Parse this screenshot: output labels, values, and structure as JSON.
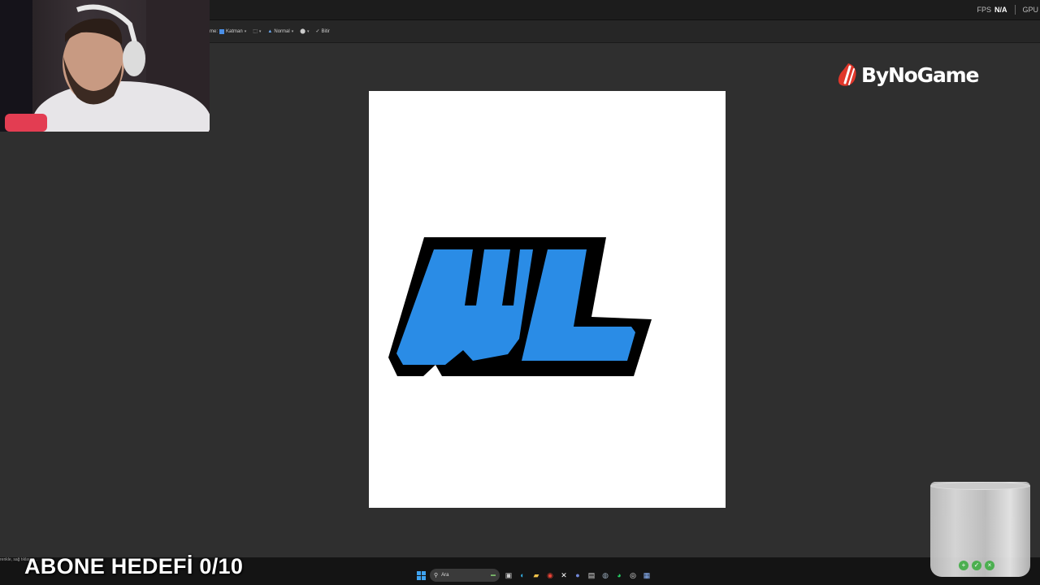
{
  "stats": {
    "fps_label": "FPS",
    "fps_value": "N/A",
    "gpu_label": "GPU"
  },
  "options_bar": {
    "prefix": "me:",
    "layer_label": "Katman",
    "blend_mode": "Normal",
    "done_label": "Bitir"
  },
  "brand": {
    "name": "ByNoGame"
  },
  "canvas_logo": {
    "letters": "WL",
    "fill": "#2a8ce6",
    "outline": "#000000"
  },
  "overlay": {
    "hint": "renkle, sağ tıklayın...",
    "subscriber_goal": "ABONE HEDEFİ 0/10"
  },
  "taskbar": {
    "search_placeholder": "Ara",
    "icons": [
      "windows-start-icon",
      "search-icon",
      "widget-icon",
      "task-view-icon",
      "edge-icon",
      "file-explorer-icon",
      "chrome-icon",
      "x-icon",
      "discord-icon",
      "notepad-icon",
      "steam-icon",
      "whatsapp-icon",
      "obs-icon",
      "paint-icon"
    ]
  },
  "colors": {
    "accent_blue": "#2a8ce6",
    "brand_red": "#e0372b"
  }
}
